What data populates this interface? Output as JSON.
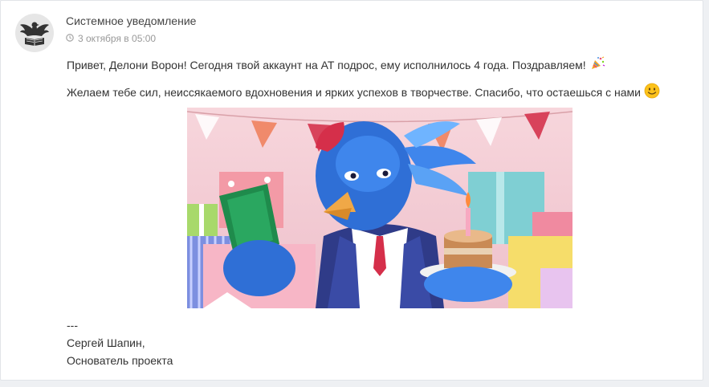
{
  "notification": {
    "sender": "Системное уведомление",
    "date": "3 октября в 05:00",
    "message_line1": "Привет, Делони Ворон! Сегодня твой аккаунт на АТ подрос, ему исполнилось 4 года. Поздравляем!",
    "message_line2": "Желаем тебе сил, неиссякаемого вдохновения и ярких успехов в творчестве. Спасибо, что остаешься с нами",
    "signature_dashes": "---",
    "signature_name": "Сергей Шапин,",
    "signature_role": "Основатель проекта"
  },
  "icons": {
    "avatar": "eagle-book-logo-icon",
    "date": "clock-icon",
    "party": "party-popper-icon",
    "smile": "smiley-icon"
  },
  "colors": {
    "background": "#eef0f3",
    "card": "#ffffff",
    "muted_text": "#999999",
    "text": "#333333"
  }
}
